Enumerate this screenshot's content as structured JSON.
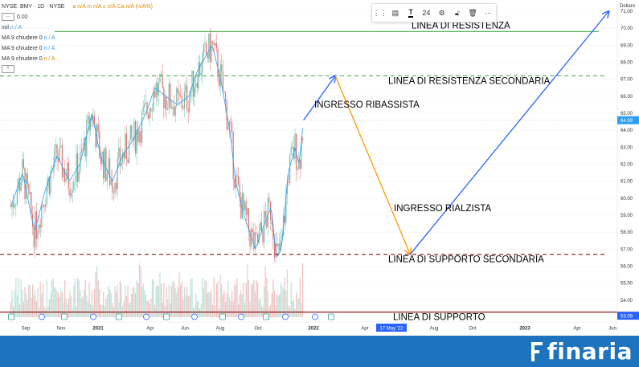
{
  "legend": {
    "symbol": "NYSE: BMY · 1D · NYSE",
    "ohlc": "a n/A m n/A c n/A Ca n/A (n/A%)",
    "volume_label": "vol",
    "volume_value": "n / A",
    "ma1_label": "MA 9 chiudere 0",
    "ma1_value": "n / A",
    "ma2_label": "MA 9 chiudere 0",
    "ma2_value": "n / A",
    "ma3_label": "MA 9 chiudere 0",
    "ma3_value": "n / A",
    "box_value": "0.02"
  },
  "toolbar": {
    "interval": "24"
  },
  "brand": {
    "name": "finaria"
  },
  "price_scale": {
    "header": "Dollaro",
    "ticks": [
      "71.00",
      "70.00",
      "69.00",
      "68.00",
      "67.00",
      "66.00",
      "65.00",
      "64.00",
      "63.00",
      "62.00",
      "61.00",
      "60.00",
      "59.00",
      "58.00",
      "57.00",
      "56.00",
      "55.00",
      "54.00"
    ],
    "current_price": "64.59",
    "support_price": "53.09"
  },
  "time_axis": {
    "labels": [
      "Sep",
      "Nov",
      "2021",
      "Apr",
      "Jun",
      "Aug",
      "Oct",
      "2022",
      "Apr",
      "17 May '22",
      "Aug",
      "Oct",
      "2023",
      "Apr",
      "Jun"
    ]
  },
  "chart_data": {
    "type": "candlestick",
    "y_unit": "USD",
    "ylim": [
      53,
      71
    ],
    "levels": [
      {
        "name": "LINEA DI RESISTENZA",
        "price": 69.8,
        "style": "solid",
        "color": "#4caf50"
      },
      {
        "name": "LINEA DI RESISTENZA SECONDARIA",
        "price": 67.2,
        "style": "dashed",
        "color": "#4caf50"
      },
      {
        "name": "LINEA DI SUPPORTO SECONDARIA",
        "price": 56.7,
        "style": "dashed",
        "color": "#8b1a1a"
      },
      {
        "name": "LINEA DI SUPPORTO",
        "price": 53.3,
        "style": "solid",
        "color": "#8b1a1a"
      }
    ],
    "annotations": {
      "short_entry": "INGRESSO RIBASSISTA",
      "long_entry": "INGRESSO RIALZISTA"
    },
    "close_path": [
      [
        "2020-08-20",
        59.5
      ],
      [
        "2020-09-10",
        61.5
      ],
      [
        "2020-10-01",
        58.0
      ],
      [
        "2020-10-20",
        60.5
      ],
      [
        "2020-11-10",
        62.5
      ],
      [
        "2020-12-01",
        61.0
      ],
      [
        "2020-12-20",
        62.0
      ],
      [
        "2021-01-10",
        65.0
      ],
      [
        "2021-01-25",
        62.5
      ],
      [
        "2021-02-15",
        61.0
      ],
      [
        "2021-03-05",
        62.5
      ],
      [
        "2021-03-25",
        63.5
      ],
      [
        "2021-04-15",
        65.0
      ],
      [
        "2021-05-01",
        66.5
      ],
      [
        "2021-05-20",
        66.0
      ],
      [
        "2021-06-10",
        65.5
      ],
      [
        "2021-06-30",
        66.0
      ],
      [
        "2021-07-15",
        67.5
      ],
      [
        "2021-08-01",
        68.5
      ],
      [
        "2021-08-10",
        69.0
      ],
      [
        "2021-08-25",
        67.0
      ],
      [
        "2021-09-10",
        64.0
      ],
      [
        "2021-09-20",
        61.0
      ],
      [
        "2021-10-05",
        59.0
      ],
      [
        "2021-10-25",
        57.0
      ],
      [
        "2021-11-10",
        58.5
      ],
      [
        "2021-11-22",
        59.5
      ],
      [
        "2021-12-01",
        56.5
      ],
      [
        "2021-12-10",
        57.0
      ],
      [
        "2021-12-22",
        61.5
      ],
      [
        "2022-01-03",
        63.0
      ],
      [
        "2022-01-10",
        62.0
      ],
      [
        "2022-01-18",
        64.59
      ]
    ],
    "projection": [
      {
        "from": [
          "2022-01-18",
          64.59
        ],
        "to": [
          "2022-03-15",
          67.2
        ],
        "color": "#2962ff"
      },
      {
        "from": [
          "2022-03-15",
          67.2
        ],
        "to": [
          "2022-07-25",
          56.7
        ],
        "color": "#ff9800"
      },
      {
        "from": [
          "2022-07-25",
          56.7
        ],
        "to": [
          "2023-07-10",
          71.0
        ],
        "color": "#2962ff"
      }
    ]
  }
}
